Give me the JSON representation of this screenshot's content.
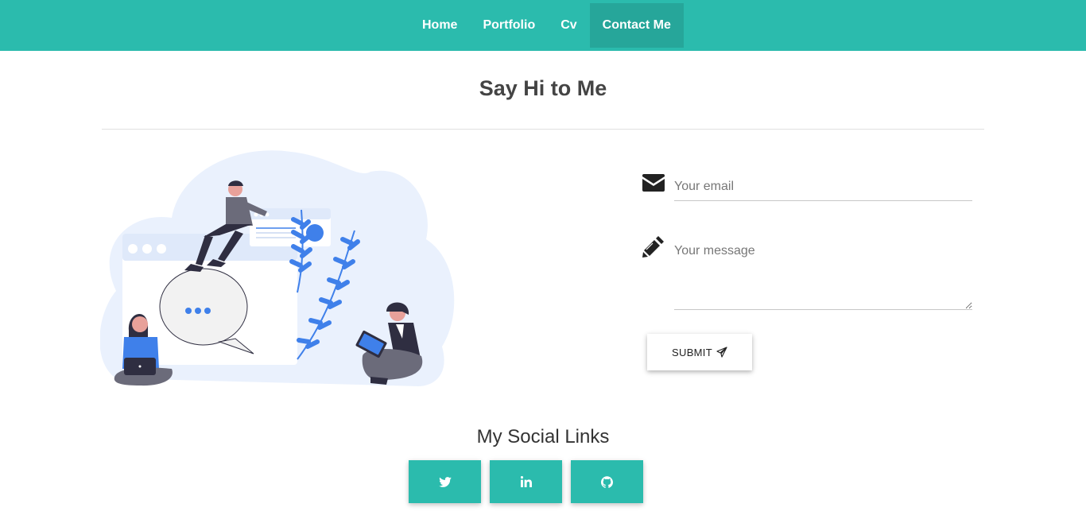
{
  "nav": {
    "items": [
      {
        "label": "Home"
      },
      {
        "label": "Portfolio"
      },
      {
        "label": "Cv"
      },
      {
        "label": "Contact Me"
      }
    ],
    "active": "Contact Me"
  },
  "page": {
    "title": "Say Hi to Me"
  },
  "form": {
    "email_placeholder": "Your email",
    "message_placeholder": "Your message",
    "submit_label": "SUBMIT",
    "email_icon": "envelope-icon",
    "message_icon": "pencil-icon",
    "submit_icon": "paper-plane-icon"
  },
  "social": {
    "title": "My Social Links",
    "links": [
      {
        "icon": "twitter-icon"
      },
      {
        "icon": "linkedin-icon"
      },
      {
        "icon": "github-icon"
      }
    ]
  },
  "colors": {
    "accent": "#2bbbad",
    "accent_active": "#26a69a",
    "illustration_blue": "#3f80ea",
    "illustration_bg": "#eaf1fd"
  }
}
